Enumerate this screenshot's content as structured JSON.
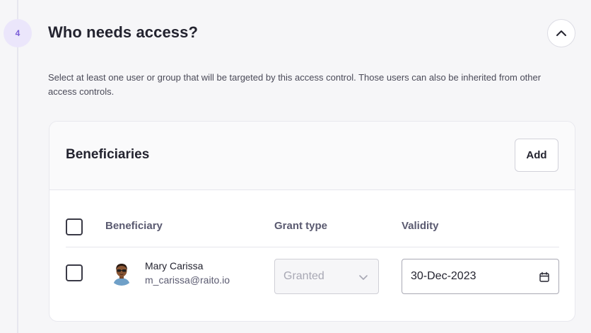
{
  "step": {
    "number": "4"
  },
  "section": {
    "title": "Who needs access?",
    "description": "Select at least one user or group that will be targeted by this access control. Those users can also be inherited from other access controls."
  },
  "card": {
    "title": "Beneficiaries",
    "add_label": "Add",
    "columns": {
      "beneficiary": "Beneficiary",
      "grant_type": "Grant type",
      "validity": "Validity"
    },
    "rows": [
      {
        "name": "Mary Carissa",
        "email": "m_carissa@raito.io",
        "grant_type": "Granted",
        "validity": "30-Dec-2023"
      }
    ]
  },
  "colors": {
    "accent": "#7b5ed8",
    "accent_bg": "#ebe6fb",
    "text": "#23232f",
    "muted": "#5a5a70"
  },
  "icons": [
    "chevron-up-icon",
    "chevron-down-icon",
    "calendar-icon",
    "avatar"
  ]
}
